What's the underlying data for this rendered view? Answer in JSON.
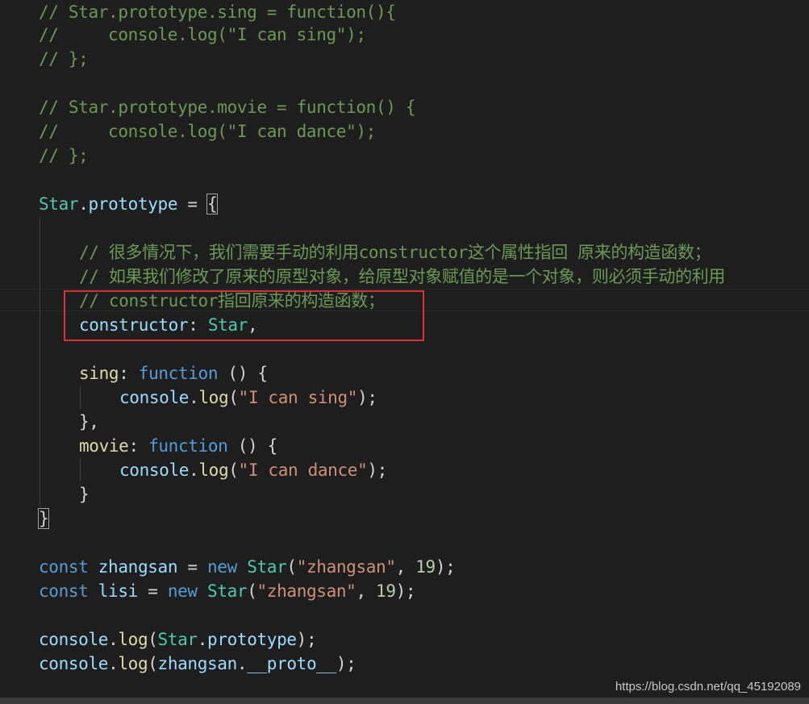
{
  "editor": {
    "lines": {
      "l1": "// Star.prototype.sing = function(){",
      "l2": "//     console.log(\"I can sing\");",
      "l3": "// };",
      "l5": "// Star.prototype.movie = function() {",
      "l6": "//     console.log(\"I can dance\");",
      "l7": "// };",
      "l9a": "Star",
      "l9b": ".",
      "l9c": "prototype",
      "l9d": " = ",
      "l9e": "{",
      "l11": "// 很多情况下，我们需要手动的利用constructor这个属性指回 原来的构造函数；",
      "l12": "// 如果我们修改了原来的原型对象，给原型对象赋值的是一个对象，则必须手动的利用",
      "l13": "// constructor指回原来的构造函数；",
      "l14a": "constructor",
      "l14b": ": ",
      "l14c": "Star",
      "l14d": ",",
      "l16a": "sing",
      "l16b": ": ",
      "l16c": "function",
      "l16d": " () {",
      "l17a": "console",
      "l17b": ".",
      "l17c": "log",
      "l17d": "(",
      "l17e": "\"I can sing\"",
      "l17f": ");",
      "l18": "},",
      "l19a": "movie",
      "l19b": ": ",
      "l19c": "function",
      "l19d": " () {",
      "l20a": "console",
      "l20b": ".",
      "l20c": "log",
      "l20d": "(",
      "l20e": "\"I can dance\"",
      "l20f": ");",
      "l21": "}",
      "l22": "}",
      "l24a": "const",
      "l24b": " ",
      "l24c": "zhangsan",
      "l24d": " = ",
      "l24e": "new",
      "l24f": " ",
      "l24g": "Star",
      "l24h": "(",
      "l24i": "\"zhangsan\"",
      "l24j": ", ",
      "l24k": "19",
      "l24l": ");",
      "l25a": "const",
      "l25b": " ",
      "l25c": "lisi",
      "l25d": " = ",
      "l25e": "new",
      "l25f": " ",
      "l25g": "Star",
      "l25h": "(",
      "l25i": "\"zhangsan\"",
      "l25j": ", ",
      "l25k": "19",
      "l25l": ");",
      "l27a": "console",
      "l27b": ".",
      "l27c": "log",
      "l27d": "(",
      "l27e": "Star",
      "l27f": ".",
      "l27g": "prototype",
      "l27h": ");",
      "l28a": "console",
      "l28b": ".",
      "l28c": "log",
      "l28d": "(",
      "l28e": "zhangsan",
      "l28f": ".",
      "l28g": "__proto__",
      "l28h": ");"
    }
  },
  "watermark": "https://blog.csdn.net/qq_45192089",
  "theme": {
    "background": "#1e1e1e",
    "comment": "#6a9955",
    "variable": "#9cdcfe",
    "class": "#4ec9b0",
    "function": "#dcdcaa",
    "keyword": "#569cd6",
    "string": "#ce9178",
    "number": "#b5cea8",
    "annotation_box": "#d8313a"
  }
}
